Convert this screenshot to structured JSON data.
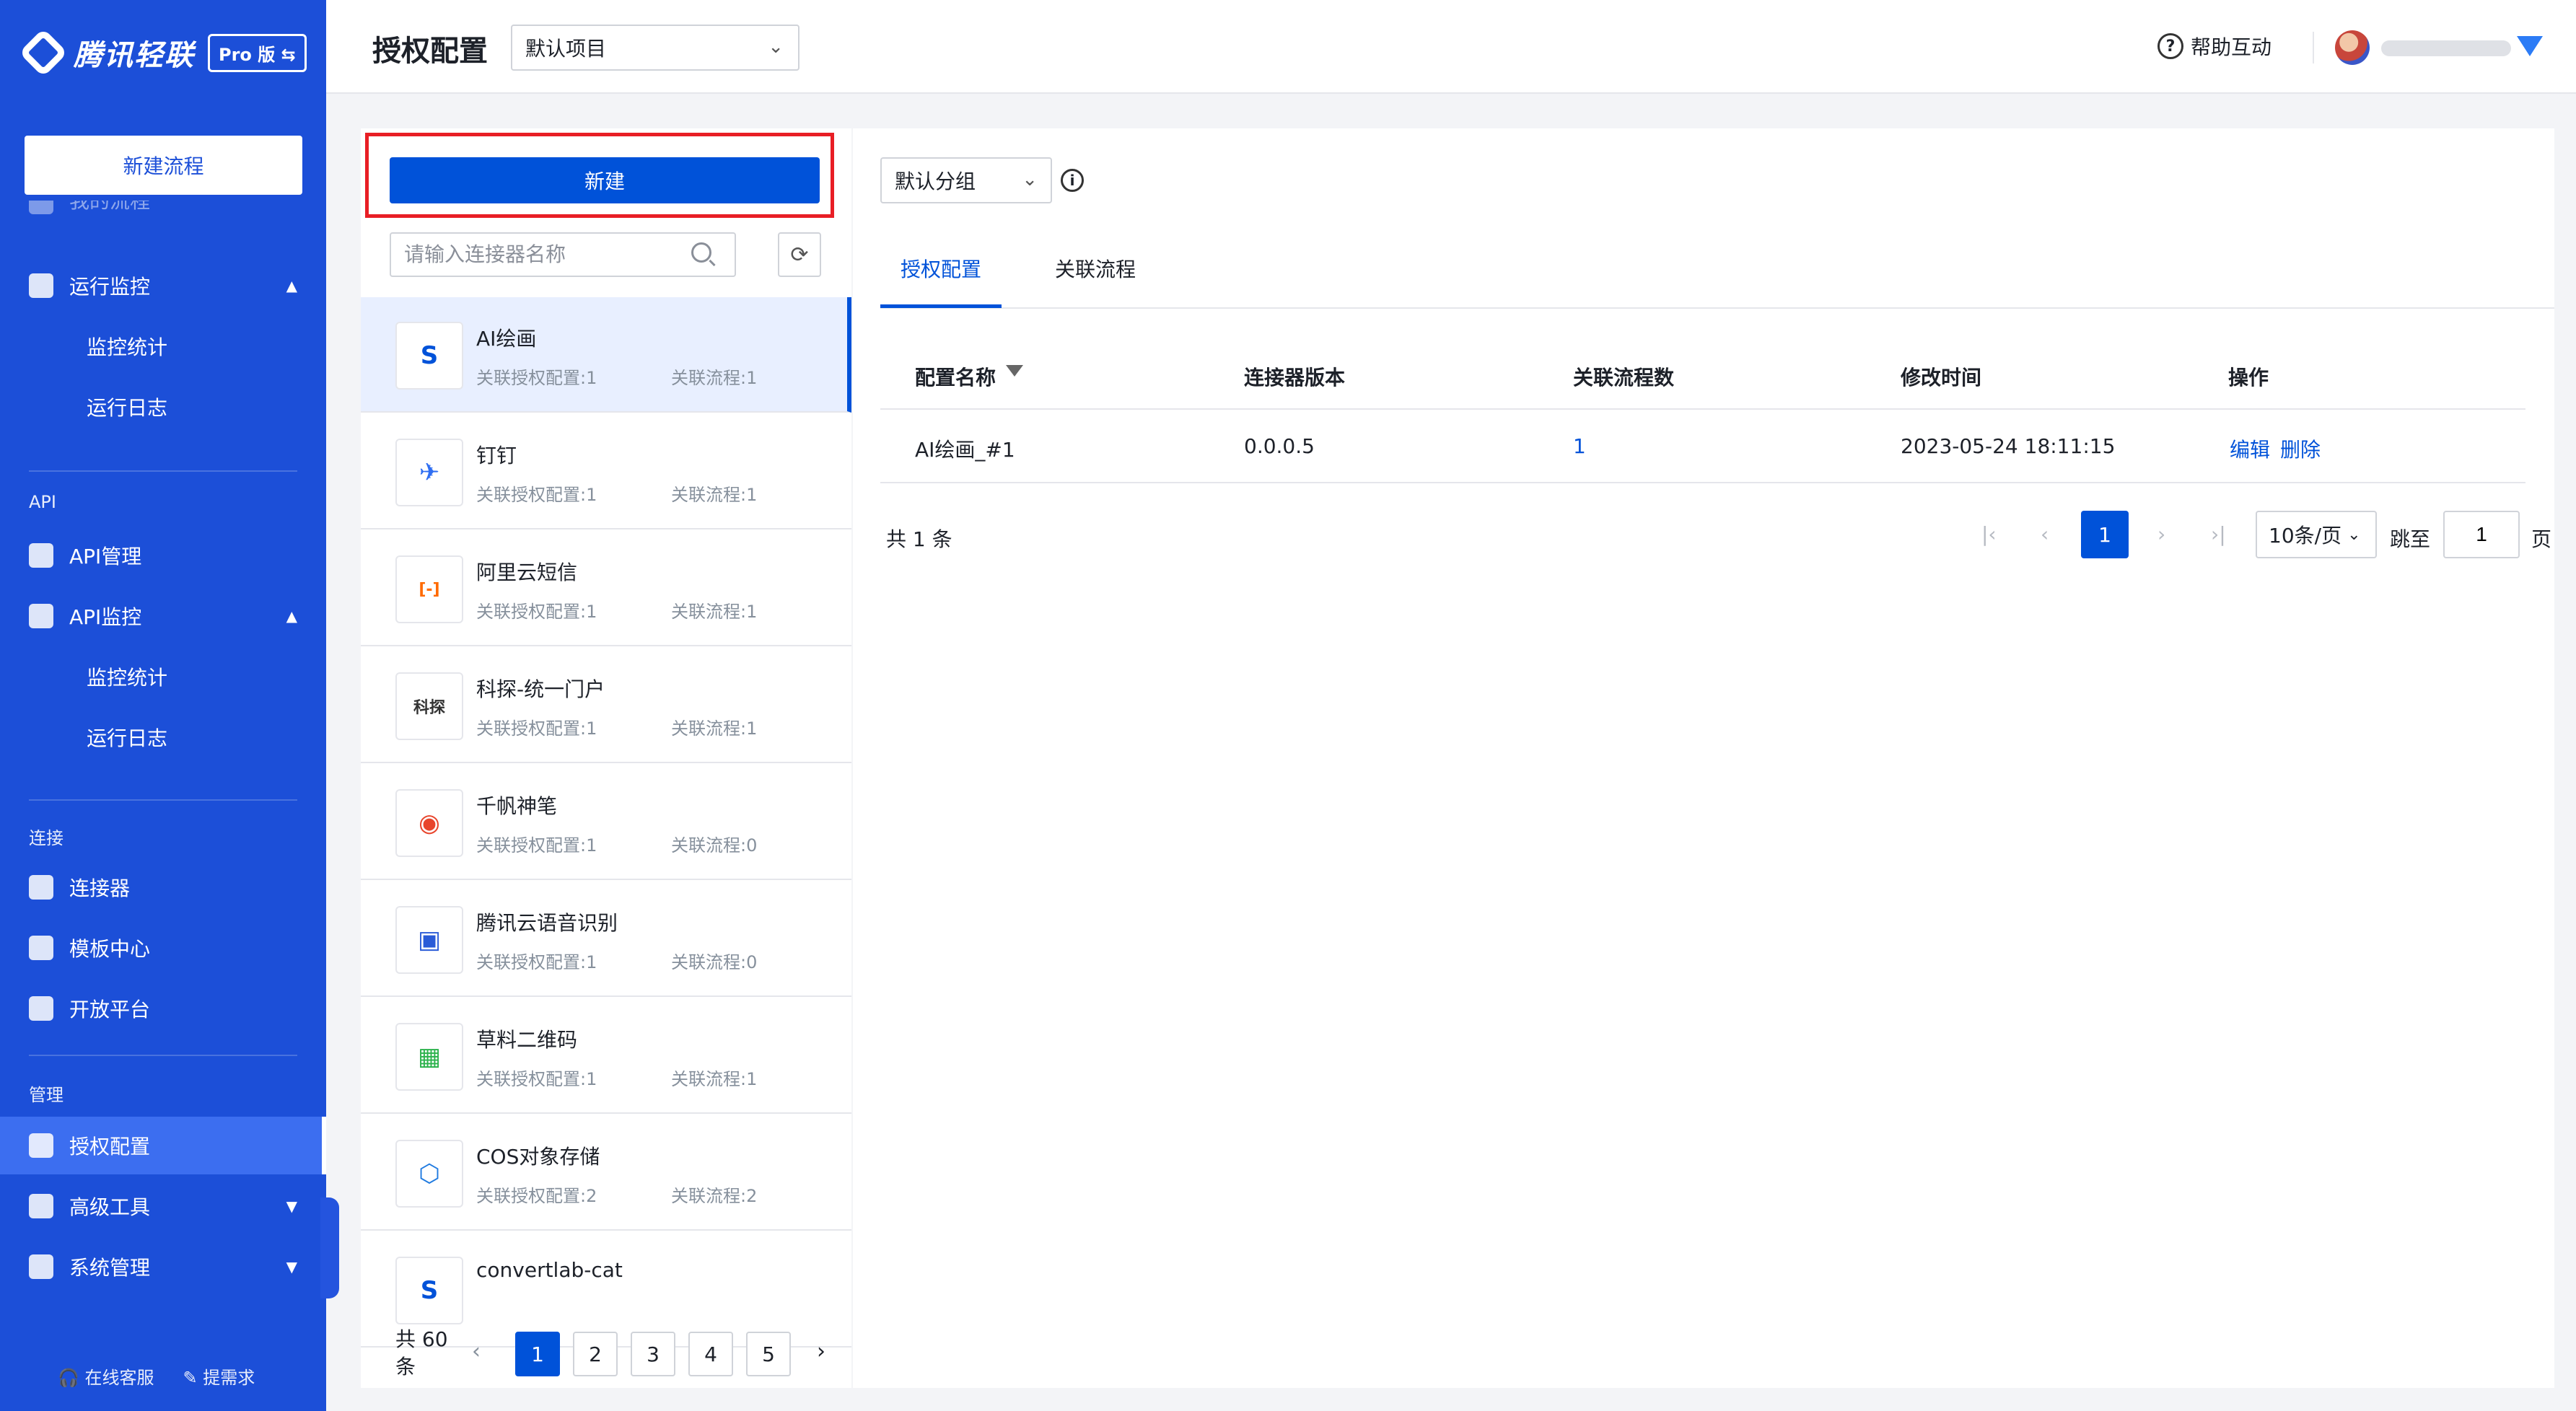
{
  "sidebar": {
    "brand": "腾讯轻联",
    "edition": "Pro 版 ⇆",
    "new_flow": "新建流程",
    "partial_item": "我的流程",
    "run_monitor": "运行监控",
    "run_sub": [
      "监控统计",
      "运行日志"
    ],
    "group_api": "API",
    "api_manage": "API管理",
    "api_monitor": "API监控",
    "api_sub": [
      "监控统计",
      "运行日志"
    ],
    "group_connect": "连接",
    "connectors": "连接器",
    "templates": "模板中心",
    "open_platform": "开放平台",
    "group_manage": "管理",
    "auth_config": "授权配置",
    "advanced_tools": "高级工具",
    "system_manage": "系统管理",
    "support": "在线客服",
    "feedback": "提需求"
  },
  "header": {
    "title": "授权配置",
    "project": "默认项目",
    "help": "帮助互动"
  },
  "left": {
    "create_label": "新建",
    "search_placeholder": "请输入连接器名称",
    "connectors": [
      {
        "name": "AI绘画",
        "auth": "关联授权配置:1",
        "flow": "关联流程:1",
        "logo": "S",
        "color": "#0052d9"
      },
      {
        "name": "钉钉",
        "auth": "关联授权配置:1",
        "flow": "关联流程:1",
        "logo": "✈",
        "color": "#2f6ef2"
      },
      {
        "name": "阿里云短信",
        "auth": "关联授权配置:1",
        "flow": "关联流程:1",
        "logo": "[-]",
        "color": "#ff6a00"
      },
      {
        "name": "科探-统一门户",
        "auth": "关联授权配置:1",
        "flow": "关联流程:1",
        "logo": "科探",
        "color": "#333333"
      },
      {
        "name": "千帆神笔",
        "auth": "关联授权配置:1",
        "flow": "关联流程:0",
        "logo": "◉",
        "color": "#e8452c"
      },
      {
        "name": "腾讯云语音识别",
        "auth": "关联授权配置:1",
        "flow": "关联流程:0",
        "logo": "▣",
        "color": "#2a5bd7"
      },
      {
        "name": "草料二维码",
        "auth": "关联授权配置:1",
        "flow": "关联流程:1",
        "logo": "▦",
        "color": "#2bb24c"
      },
      {
        "name": "COS对象存储",
        "auth": "关联授权配置:2",
        "flow": "关联流程:2",
        "logo": "⬡",
        "color": "#1f7ae0"
      },
      {
        "name": "convertlab-cat",
        "auth": "",
        "flow": "",
        "logo": "S",
        "color": "#0052d9"
      }
    ],
    "total": "共 60 条",
    "pages": [
      "1",
      "2",
      "3",
      "4",
      "5"
    ]
  },
  "right": {
    "group": "默认分组",
    "tabs": [
      "授权配置",
      "关联流程"
    ],
    "columns": [
      "配置名称",
      "连接器版本",
      "关联流程数",
      "修改时间",
      "操作"
    ],
    "rows": [
      {
        "name": "AI绘画_#1",
        "version": "0.0.0.5",
        "flows": "1",
        "modified": "2023-05-24 18:11:15",
        "edit": "编辑",
        "delete": "删除"
      }
    ],
    "total": "共 1 条",
    "current_page": "1",
    "page_size": "10条/页",
    "jump_label": "跳至",
    "jump_value": "1",
    "page_unit": "页"
  }
}
